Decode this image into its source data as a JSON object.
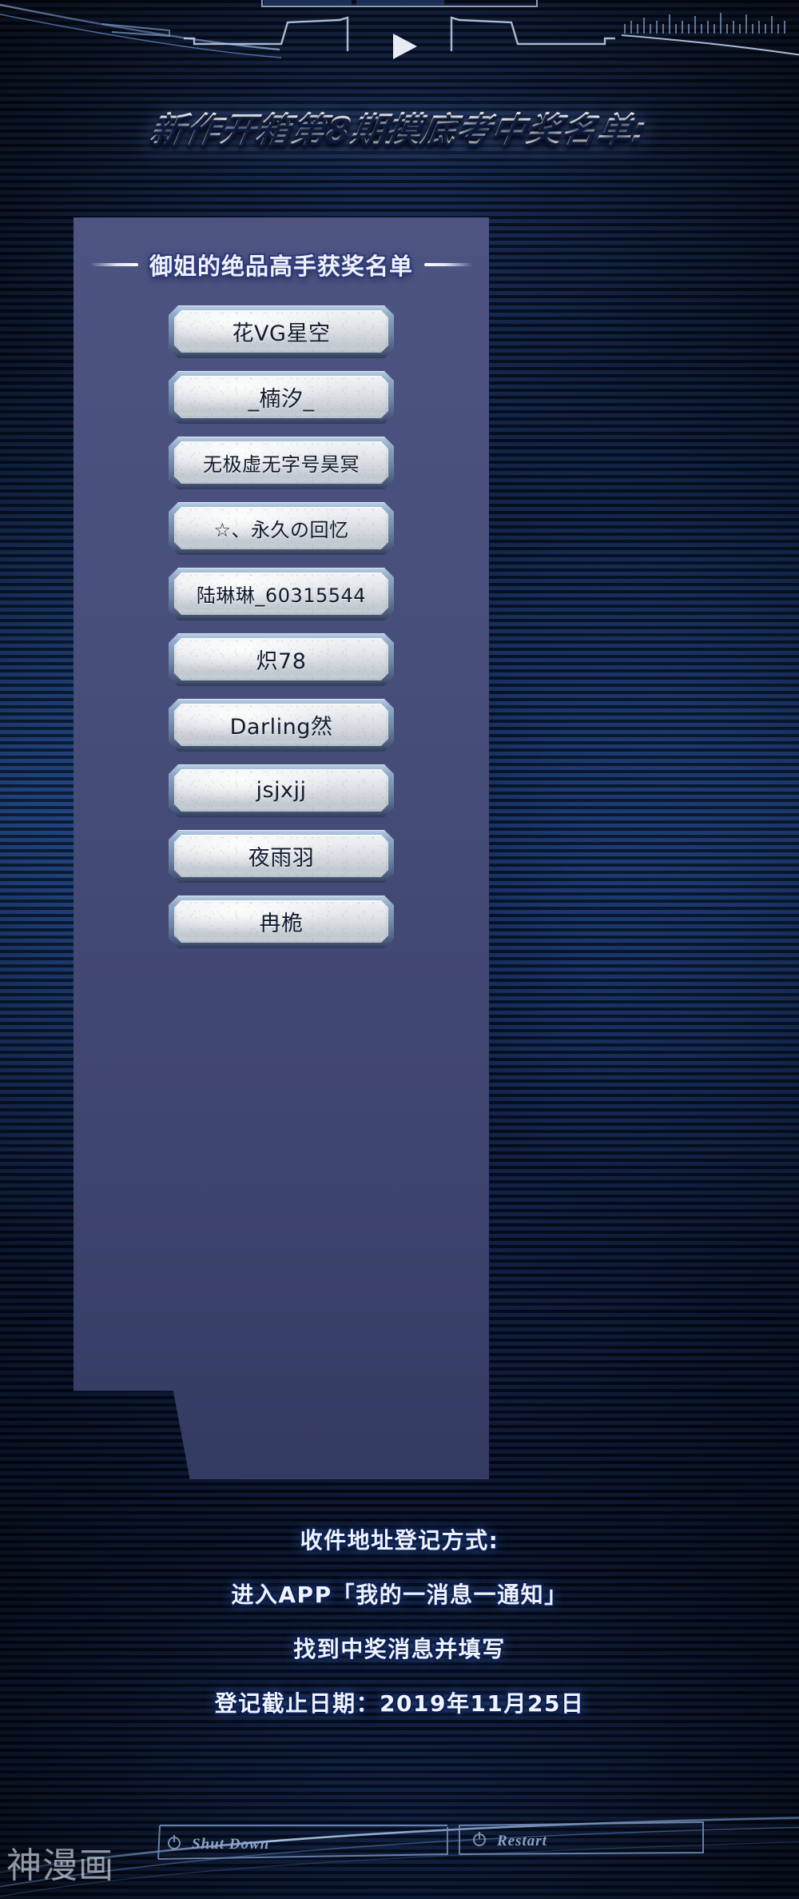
{
  "main_title": "新作开箱第8期摸底考中奖名单:",
  "panel": {
    "header": "御姐的绝品高手获奖名单",
    "winners": [
      {
        "name": "花VG星空"
      },
      {
        "name": "_楠汐_"
      },
      {
        "name": "无极虚无字号昊冥"
      },
      {
        "name": "☆、永久の回忆"
      },
      {
        "name": "陆琳琳_60315544"
      },
      {
        "name": "炽78"
      },
      {
        "name": "Darling然"
      },
      {
        "name": "jsjxjj"
      },
      {
        "name": "夜雨羽"
      },
      {
        "name": "冉桅"
      }
    ]
  },
  "footer": {
    "lines": [
      "收件地址登记方式:",
      "进入APP「我的一消息一通知」",
      "找到中奖消息并填写",
      "登记截止日期：2019年11月25日"
    ]
  },
  "hud": {
    "shutdown_label": "Shut Down",
    "restart_label": "Restart"
  },
  "watermark": "神漫画",
  "colors": {
    "background_deep": "#081229",
    "background_glow": "#2e6ccd",
    "panel": "#474e7a",
    "button_face": "#e6e9ec",
    "button_frame": "#6d86a8",
    "text_light": "#eef3fd",
    "text_outline": "#0b1e52",
    "hud_line": "#8ba4c8"
  }
}
